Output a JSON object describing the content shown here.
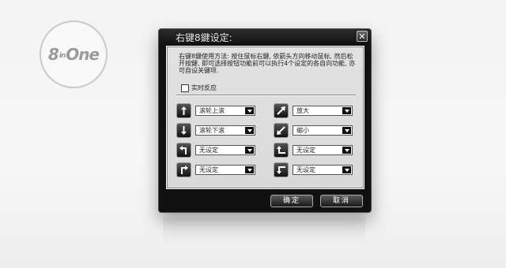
{
  "logo": {
    "text_a": "8",
    "text_b": "in",
    "text_c": "One"
  },
  "dialog": {
    "title": "右键8鍵设定:",
    "description": "右键8鍵使用方法: 按住鼠标右鍵, 依箭头方向移动鼠标, 然后松开按鍵, 即可选择按钮功能前可以执行4个设定的各自向功能, 亦可自设关键项.",
    "realtime_label": "实时反应",
    "left_column": [
      {
        "icon": "arrow-up-icon",
        "value": "滚轮上滚"
      },
      {
        "icon": "arrow-down-icon",
        "value": "滚轮下滚"
      },
      {
        "icon": "arrow-up-left-turn-icon",
        "value": "无设定"
      },
      {
        "icon": "arrow-up-right-turn-icon",
        "value": "无设定"
      }
    ],
    "right_column": [
      {
        "icon": "arrow-diagonal-up-right-icon",
        "value": "放大"
      },
      {
        "icon": "arrow-diagonal-down-left-icon",
        "value": "缩小"
      },
      {
        "icon": "arrow-left-up-turn-icon",
        "value": "无设定"
      },
      {
        "icon": "arrow-left-down-turn-icon",
        "value": "无设定"
      }
    ],
    "ok_label": "确定",
    "cancel_label": "取消"
  }
}
